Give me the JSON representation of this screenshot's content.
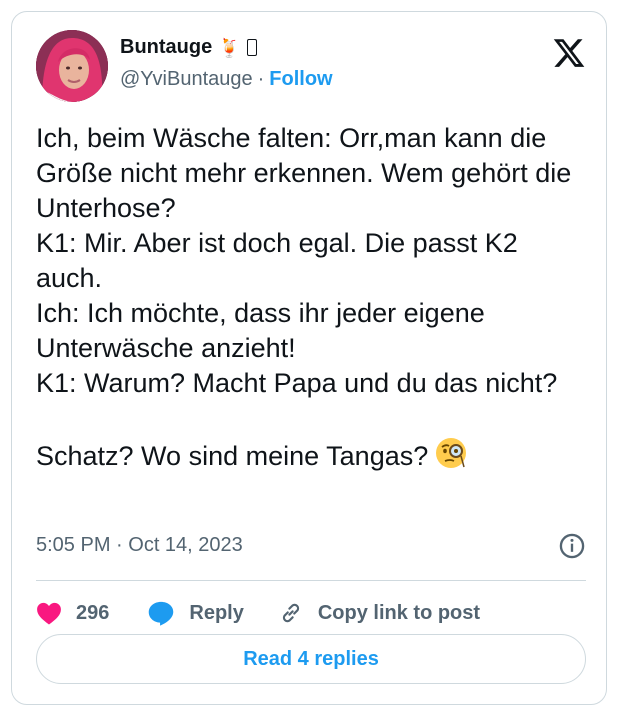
{
  "author": {
    "display_name": "Buntauge",
    "emoji_1": "🍹",
    "handle": "@YviBuntauge",
    "separator": "·",
    "follow_label": "Follow"
  },
  "tweet": {
    "text": "Ich, beim Wäsche falten: Orr,man kann die Größe nicht mehr erkennen. Wem gehört die Unterhose?\nK1: Mir. Aber ist doch egal. Die passt K2 auch.\nIch: Ich möchte, dass ihr jeder eigene Unterwäsche anzieht!\nK1: Warum? Macht Papa und du das nicht?\n\nSchatz? Wo sind meine Tangas?",
    "timestamp": "5:05 PM · Oct 14, 2023"
  },
  "actions": {
    "like_count": "296",
    "reply_label": "Reply",
    "copy_label": "Copy link to post"
  },
  "read_replies_label": "Read 4 replies",
  "colors": {
    "accent": "#1d9bf0",
    "like": "#f91880",
    "secondary_text": "#536471",
    "border": "#cfd9de"
  },
  "icons": [
    "x-logo-icon",
    "info-icon",
    "heart-icon",
    "reply-bubble-icon",
    "link-icon",
    "monocle-face-emoji"
  ]
}
